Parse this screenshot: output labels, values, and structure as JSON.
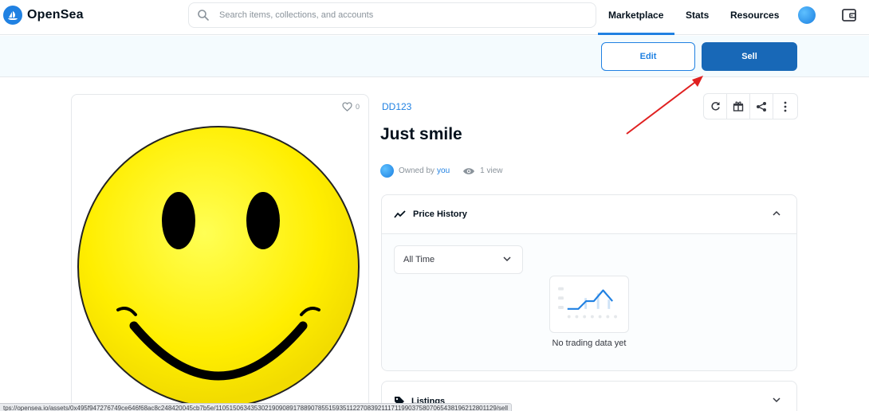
{
  "nav": {
    "brand": "OpenSea",
    "search_placeholder": "Search items, collections, and accounts",
    "links": [
      "Marketplace",
      "Stats",
      "Resources"
    ]
  },
  "actions": {
    "edit_label": "Edit",
    "sell_label": "Sell"
  },
  "item": {
    "favorites_count": "0",
    "collection": "DD123",
    "title": "Just smile",
    "owned_by_prefix": "Owned by",
    "owner": "you",
    "views": "1 view"
  },
  "price_history": {
    "label": "Price History",
    "range_selected": "All Time",
    "empty_text": "No trading data yet"
  },
  "listings": {
    "label": "Listings"
  },
  "status_url": "tps://opensea.io/assets/0x495f947276749ce646f68ac8c248420045cb7b5e/11051506343530219090891788907855159351122708392111711990375807065438196212801129/sell",
  "colors": {
    "accent": "#2081e2",
    "sell_button": "#1868b7",
    "annotation_arrow": "#e02020",
    "smiley_yellow": "#ffee00"
  },
  "icons": [
    "search-icon",
    "wallet-icon",
    "heart-icon",
    "refresh-icon",
    "gift-icon",
    "share-icon",
    "more-icon",
    "eye-icon",
    "chart-line-icon",
    "chevron-up-icon",
    "chevron-down-icon",
    "tag-icon"
  ]
}
